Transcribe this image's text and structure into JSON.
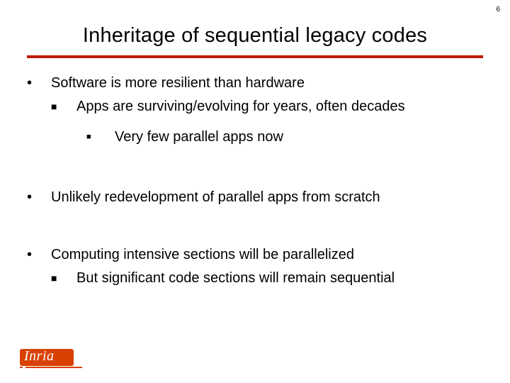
{
  "page_number": "6",
  "title": "Inheritage of sequential legacy codes",
  "colors": {
    "accent": "#c21700",
    "logo": "#d84100"
  },
  "bullets": {
    "b1": "Software is more resilient than hardware",
    "b1_1": "Apps  are surviving/evolving for years, often decades",
    "b1_1_1": "Very few parallel apps now",
    "b2": "Unlikely redevelopment of parallel apps from scratch",
    "b3": "Computing intensive sections will be parallelized",
    "b3_1": "But significant code sections will remain sequential"
  },
  "logo_text": "Inria"
}
